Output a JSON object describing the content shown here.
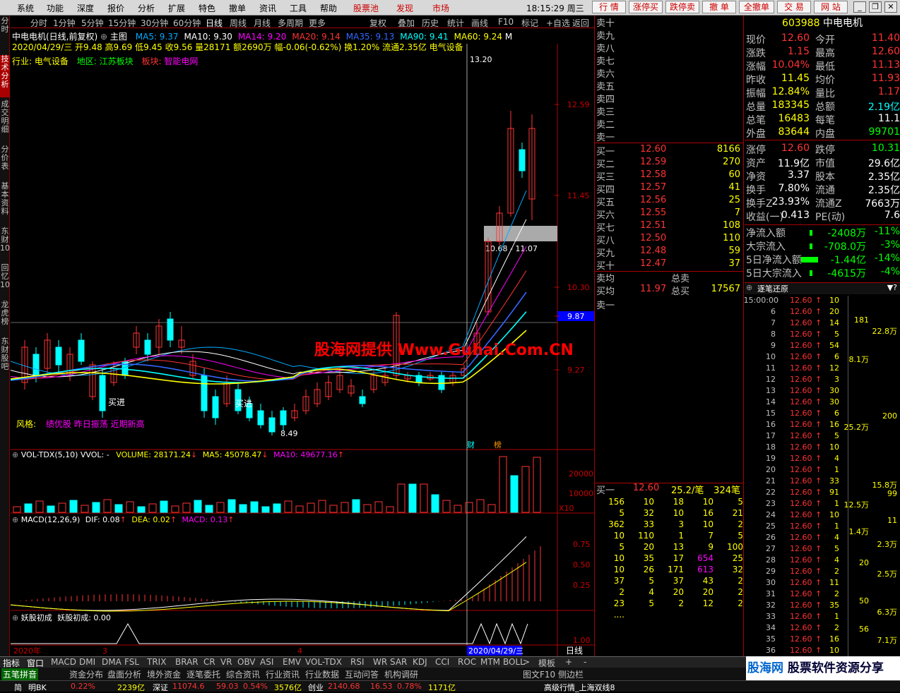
{
  "menu": {
    "items": [
      "系统",
      "功能",
      "深度",
      "报价",
      "分析",
      "扩展",
      "特色",
      "撤单",
      "资讯",
      "工具",
      "帮助"
    ],
    "hot": [
      "股票池",
      "发现",
      "市场"
    ],
    "clock": "18:15:29 周三",
    "right": [
      "行 情",
      "涨停买",
      "跌停卖",
      "撤 单",
      "全撤单",
      "交 易",
      "网 站"
    ]
  },
  "left_tabs": [
    "分时",
    "技术分析",
    "成交明细",
    "分价表",
    "基本资料",
    "东财10",
    "回忆10",
    "龙虎榜",
    "东财股吧"
  ],
  "timeframes": [
    "分时",
    "1分钟",
    "5分钟",
    "15分钟",
    "30分钟",
    "60分钟",
    "日线",
    "周线",
    "月线",
    "多周期",
    "更多"
  ],
  "tools": [
    "复权",
    "叠加",
    "历史",
    "统计",
    "画线",
    "F10",
    "标记",
    "+自选",
    "返回"
  ],
  "header": {
    "name": "中电电机(日线,前复权)",
    "main_label": "主图",
    "ma": [
      {
        "t": "MA5: 9.37",
        "c": "#0af"
      },
      {
        "t": "MA10: 9.30",
        "c": "#fff"
      },
      {
        "t": "MA14: 9.20",
        "c": "#f0f"
      },
      {
        "t": "MA20: 9.14",
        "c": "#f33"
      },
      {
        "t": "MA35: 9.13",
        "c": "#36f"
      },
      {
        "t": "MA90: 9.41",
        "c": "#0ff"
      },
      {
        "t": "MA60: 9.24",
        "c": "#ff0"
      }
    ],
    "m": "M",
    "info1": "2020/04/29/三 开9.48 高9.69 低9.45 收9.56 量28171 额2690万 幅-0.06(-0.62%) 换1.20% 流通2.35亿 电气设备",
    "industry": "行业:",
    "industry_v": "电气设备",
    "region": "地区:",
    "region_v": "江苏板块",
    "block": "板块:",
    "block_v": "智能电网",
    "style_label": "风格:",
    "style_v": "绩优股 昨日振荡 近期新高",
    "buy1": "买进",
    "buy2": "买进"
  },
  "price_axis": [
    "12.59",
    "11.45",
    "10.30",
    "9.87",
    "9.27"
  ],
  "annot": {
    "high": "13.20",
    "low": "8.49",
    "band": "10.68 - 11.07",
    "cai": "财",
    "bang": "榜"
  },
  "vol": {
    "title": "VOL-TDX(5,10)",
    "vvol": "VVOL: -",
    "volume": "VOLUME: 28171.24",
    "ma5": "MA5: 45078.47",
    "ma10": "MA10: 49677.16",
    "axis": [
      "20000",
      "10000",
      "X10"
    ]
  },
  "macd": {
    "title": "MACD(12,26,9)",
    "dif": "DIF: 0.08",
    "dea": "DEA: 0.02",
    "macd": "MACD: 0.13",
    "axis": [
      "0.75",
      "0.50",
      "0.25"
    ]
  },
  "yao": {
    "title": "妖股初成",
    "val": "妖股初成: 0.00",
    "axis": [
      "1.00"
    ]
  },
  "dates": {
    "y": "2020年",
    "m3": "3",
    "m4": "4",
    "cur": "2020/04/29/三",
    "period": "日线"
  },
  "ob": {
    "sells": [
      "卖十",
      "卖九",
      "卖八",
      "卖七",
      "卖六",
      "卖五",
      "卖四",
      "卖三",
      "卖二",
      "卖一"
    ],
    "buys": [
      [
        "买一",
        "12.60",
        "8166"
      ],
      [
        "买二",
        "12.59",
        "270"
      ],
      [
        "买三",
        "12.58",
        "60"
      ],
      [
        "买四",
        "12.57",
        "41"
      ],
      [
        "买五",
        "12.56",
        "25"
      ],
      [
        "买六",
        "12.55",
        "7"
      ],
      [
        "买七",
        "12.51",
        "108"
      ],
      [
        "买八",
        "12.50",
        "110"
      ],
      [
        "买九",
        "12.48",
        "59"
      ],
      [
        "买十",
        "12.47",
        "37"
      ]
    ],
    "avg_sell": "卖均",
    "total_sell": "总卖",
    "avg_buy": "买均",
    "avg_buy_v": "11.97",
    "total_buy": "总买",
    "total_buy_v": "17567",
    "sell1": "卖一",
    "queue_label": "买一",
    "queue_price": "12.60",
    "queue_amt": "25.2/笔",
    "queue_cnt": "324笔",
    "queue": [
      [
        "156",
        "10",
        "18",
        "10",
        "5"
      ],
      [
        "5",
        "32",
        "10",
        "16",
        "21"
      ],
      [
        "362",
        "33",
        "3",
        "10",
        "2"
      ],
      [
        "10",
        "110",
        "1",
        "7",
        "5"
      ],
      [
        "5",
        "20",
        "13",
        "9",
        "100"
      ],
      [
        "10",
        "35",
        "17",
        "654",
        "25"
      ],
      [
        "10",
        "26",
        "171",
        "613",
        "32"
      ],
      [
        "37",
        "5",
        "37",
        "43",
        "2"
      ],
      [
        "2",
        "4",
        "20",
        "20",
        "2"
      ],
      [
        "23",
        "5",
        "2",
        "12",
        "2"
      ],
      [
        "....",
        "",
        "",
        "",
        ""
      ]
    ]
  },
  "info": {
    "code": "603988",
    "name": "中电电机",
    "rows": [
      [
        "现价",
        "12.60",
        "今开",
        "11.40"
      ],
      [
        "涨跌",
        "1.15",
        "最高",
        "12.60"
      ],
      [
        "涨幅",
        "10.04%",
        "最低",
        "11.13"
      ],
      [
        "昨收",
        "11.45",
        "均价",
        "11.93"
      ],
      [
        "振幅",
        "12.84%",
        "量比",
        "1.17"
      ],
      [
        "总量",
        "183345",
        "总额",
        "2.19亿"
      ],
      [
        "总笔",
        "16483",
        "每笔",
        "11.1"
      ],
      [
        "外盘",
        "83644",
        "内盘",
        "99701"
      ],
      [
        "涨停",
        "12.60",
        "跌停",
        "10.31"
      ],
      [
        "资产",
        "11.9亿",
        "市值",
        "29.6亿"
      ],
      [
        "净资",
        "3.37",
        "股本",
        "2.35亿"
      ],
      [
        "换手",
        "7.80%",
        "流通",
        "2.35亿"
      ],
      [
        "换手Z",
        "23.93%",
        "流通Z",
        "7663万"
      ],
      [
        "收益(一)",
        "0.413",
        "PE(动)",
        "7.6"
      ]
    ],
    "flow": [
      [
        "净流入额",
        "-2408万",
        "-11%"
      ],
      [
        "大宗流入",
        "-708.0万",
        "-3%"
      ],
      [
        "5日净流入额",
        "-1.44亿",
        "-14%"
      ],
      [
        "5日大宗流入",
        "-4615万",
        "-4%"
      ]
    ]
  },
  "tick": {
    "title": "逐笔还原",
    "rows": [
      [
        "15:00:00",
        "12.60",
        "10",
        ""
      ],
      [
        "6",
        "12.60",
        "20",
        ""
      ],
      [
        "7",
        "12.60",
        "14",
        ""
      ],
      [
        "8",
        "12.60",
        "5",
        ""
      ],
      [
        "9",
        "12.60",
        "54",
        ""
      ],
      [
        "10",
        "12.60",
        "6",
        ""
      ],
      [
        "11",
        "12.60",
        "12",
        ""
      ],
      [
        "12",
        "12.60",
        "3",
        ""
      ],
      [
        "13",
        "12.60",
        "30",
        ""
      ],
      [
        "14",
        "12.60",
        "30",
        ""
      ],
      [
        "15",
        "12.60",
        "6",
        ""
      ],
      [
        "16",
        "12.60",
        "16",
        ""
      ],
      [
        "17",
        "12.60",
        "5",
        ""
      ],
      [
        "18",
        "12.60",
        "10",
        ""
      ],
      [
        "19",
        "12.60",
        "4",
        ""
      ],
      [
        "20",
        "12.60",
        "1",
        ""
      ],
      [
        "21",
        "12.60",
        "33",
        ""
      ],
      [
        "22",
        "12.60",
        "91",
        ""
      ],
      [
        "23",
        "12.60",
        "1",
        ""
      ],
      [
        "24",
        "12.60",
        "10",
        ""
      ],
      [
        "25",
        "12.60",
        "1",
        ""
      ],
      [
        "26",
        "12.60",
        "4",
        ""
      ],
      [
        "27",
        "12.60",
        "5",
        ""
      ],
      [
        "28",
        "12.60",
        "4",
        ""
      ],
      [
        "29",
        "12.60",
        "2",
        ""
      ],
      [
        "30",
        "12.60",
        "11",
        ""
      ],
      [
        "31",
        "12.60",
        "2",
        ""
      ],
      [
        "32",
        "12.60",
        "35",
        ""
      ],
      [
        "33",
        "12.60",
        "1",
        ""
      ],
      [
        "34",
        "12.60",
        "2",
        ""
      ],
      [
        "35",
        "12.60",
        "16",
        ""
      ],
      [
        "36",
        "12.60",
        "10",
        ""
      ]
    ],
    "side": [
      "181",
      "22.8万",
      "8.1万",
      "200",
      "25.2万",
      "99",
      "12.5万",
      "11",
      "1.4万",
      "2.3万",
      "20",
      "2.5万",
      "50",
      "6.3万",
      "56",
      "7.1万",
      "15.8万"
    ]
  },
  "indicators": [
    "指标",
    "窗口",
    "MACD",
    "DMI",
    "DMA",
    "FSL",
    "TRIX",
    "BRAR",
    "CR",
    "VR",
    "OBV",
    "ASI",
    "EMV",
    "VOL-TDX",
    "RSI",
    "WR",
    "SAR",
    "KDJ",
    "CCI",
    "ROC",
    "MTM",
    "BOLL"
  ],
  "bottom_right": [
    "模板",
    "+",
    "-"
  ],
  "subtabs": [
    "五笔拼音",
    "资金分布",
    "盘面分析",
    "境外资金",
    "逐笔委托",
    "综合资讯",
    "行业资讯",
    "行业数据",
    "互动问答",
    "机构调研",
    "图文F10",
    "侧边栏"
  ],
  "rtabs": [
    "队列",
    "分布",
    "龙虎",
    "风向"
  ],
  "status": {
    "a": "简",
    "b": "明BK",
    "c": "0.22%",
    "d": "2239亿",
    "e": "深证",
    "f": "11074.6",
    "g": "59.03",
    "h": "0.54%",
    "i": "3576亿",
    "j": "创业",
    "k": "2140.68",
    "l": "16.53",
    "m": "0.78%",
    "n": "1171亿",
    "o": "高级行情_上海双线8"
  },
  "watermark": "股海网提供 Www.Guhai.Com.CN",
  "logo": {
    "a": "股海网",
    "b": "股票软件资源分享"
  },
  "chart_data": {
    "type": "candlestick",
    "ma_labels": [
      "MA5",
      "MA10",
      "MA14",
      "MA20",
      "MA35",
      "MA90",
      "MA60"
    ],
    "last_close": 12.6,
    "high": 13.2,
    "low": 8.49
  }
}
